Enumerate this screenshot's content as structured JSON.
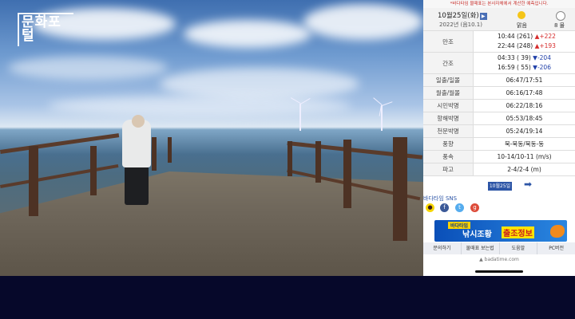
{
  "overlay_logo": "문화포털",
  "panel": {
    "notice": "*바다타임 물때표는 본사자체에서 계산한 예측입니다.",
    "date": "10월25일(화)",
    "lunar": "2022년 (음10.1)",
    "weather": "맑음",
    "tide_level": "8 물",
    "rows": [
      {
        "label": "만조",
        "lines": [
          {
            "time": "10:44 (261)",
            "dir": "up",
            "sign": "▲",
            "change": "+222"
          },
          {
            "time": "22:44 (248)",
            "dir": "up",
            "sign": "▲",
            "change": "+193"
          }
        ]
      },
      {
        "label": "간조",
        "lines": [
          {
            "time": "04:33 ( 39)",
            "dir": "down",
            "sign": "▼",
            "change": "-204"
          },
          {
            "time": "16:59 ( 55)",
            "dir": "down",
            "sign": "▼",
            "change": "-206"
          }
        ]
      }
    ],
    "info": [
      {
        "label": "일출/일몰",
        "value": "06:47/17:51"
      },
      {
        "label": "월출/월몰",
        "value": "06:16/17:48"
      },
      {
        "label": "시민박명",
        "value": "06:22/18:16"
      },
      {
        "label": "항해박명",
        "value": "05:53/18:45"
      },
      {
        "label": "천문박명",
        "value": "05:24/19:14"
      },
      {
        "label": "풍향",
        "value": "북-북동/북동-동"
      },
      {
        "label": "풍속",
        "value": "10-14/10-11 (m/s)"
      },
      {
        "label": "파고",
        "value": "2-4/2-4 (m)"
      }
    ],
    "date_button": "10월25일",
    "next_arrow": "➡",
    "sns_label": "바다타임 SNS",
    "banner_tag": "바다타임",
    "banner_text": "낚시조황",
    "banner_text2": "출조정보",
    "menu": [
      "문의하기",
      "물때표 보는법",
      "도움말",
      "PC버전"
    ],
    "footer": "▲ badatime.com"
  }
}
